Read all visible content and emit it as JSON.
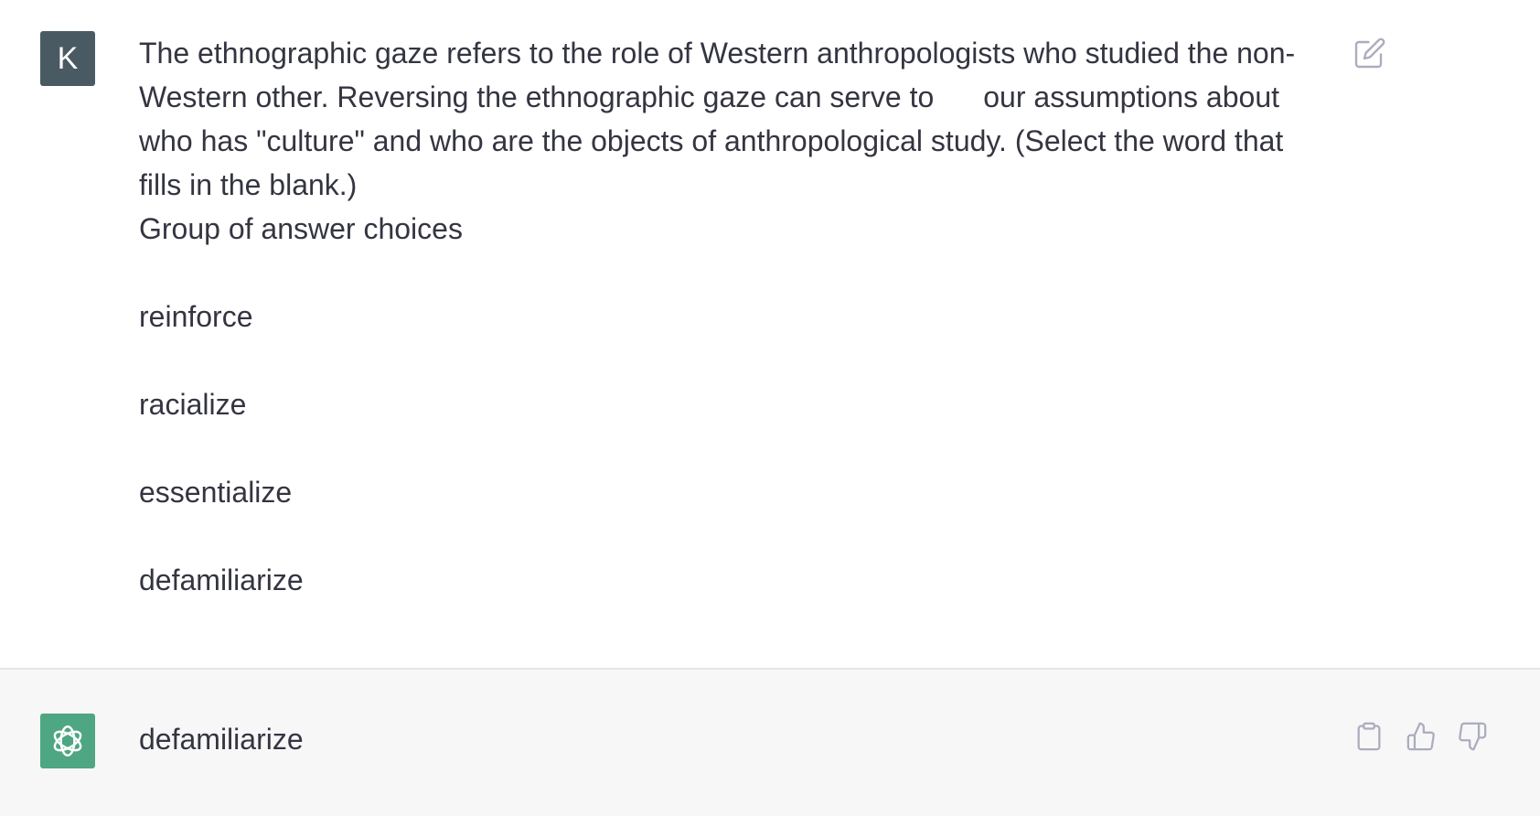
{
  "user_message": {
    "avatar_initial": "K",
    "line_1_prefix": "The ethnographic gaze refers to the role of Western anthropologists who studied the non-Western other. Reversing the ethnographic gaze can serve to",
    "line_1_suffix": "our assumptions about who has \"culture\" and who are the objects of anthropological study. (Select the word that fills in the blank.)",
    "choices_heading": "Group of answer choices",
    "choices": [
      "reinforce",
      "racialize",
      "essentialize",
      "defamiliarize"
    ],
    "edit_icon": "edit-icon"
  },
  "assistant_message": {
    "avatar_icon": "openai-logo-icon",
    "answer": "defamiliarize",
    "actions": {
      "copy_icon": "clipboard-icon",
      "thumbs_up_icon": "thumbs-up-icon",
      "thumbs_down_icon": "thumbs-down-icon"
    }
  },
  "colors": {
    "user_avatar_bg": "#4a5a63",
    "assistant_avatar_bg": "#4ea682",
    "assistant_block_bg": "#f7f7f8",
    "text": "#343541",
    "icon_muted": "#acacbe"
  }
}
